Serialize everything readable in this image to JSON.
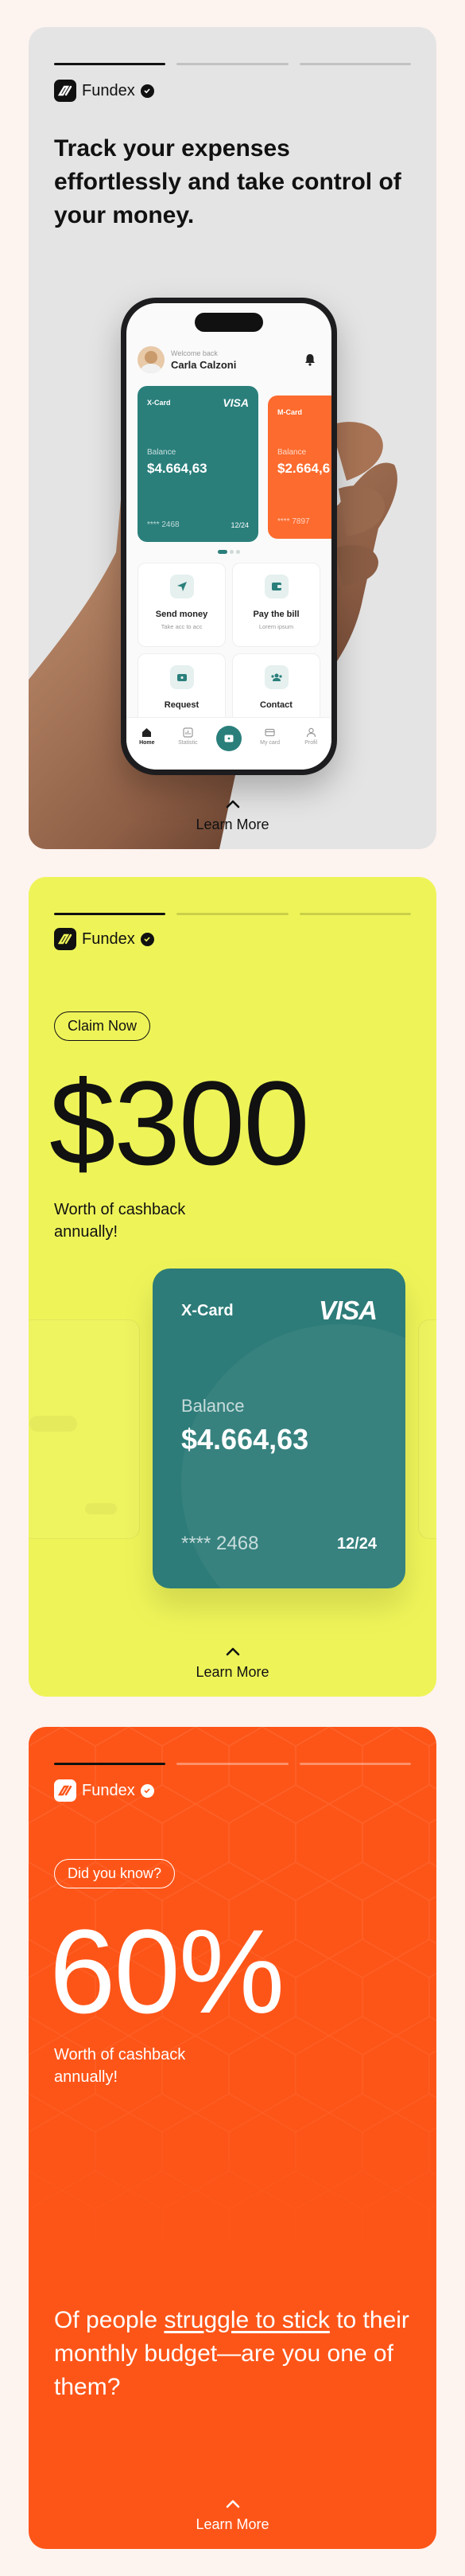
{
  "brand": {
    "name": "Fundex"
  },
  "slides": {
    "one": {
      "headline": "Track your expenses effortlessly and take control of your money.",
      "learn_more": "Learn More",
      "phone": {
        "welcome": "Welcome back",
        "user_name": "Carla Calzoni",
        "cards": [
          {
            "name": "X-Card",
            "network": "VISA",
            "balance_label": "Balance",
            "balance": "$4.664,63",
            "number": "**** 2468",
            "expiry": "12/24"
          },
          {
            "name": "M-Card",
            "balance_label": "Balance",
            "balance": "$2.664,6",
            "number": "**** 7897"
          }
        ],
        "actions": [
          {
            "title": "Send money",
            "subtitle": "Take acc to acc",
            "icon": "send-icon"
          },
          {
            "title": "Pay the bill",
            "subtitle": "Lorem ipsum",
            "icon": "bill-icon"
          },
          {
            "title": "Request",
            "subtitle": "",
            "icon": "wallet-icon"
          },
          {
            "title": "Contact",
            "subtitle": "",
            "icon": "contacts-icon"
          }
        ],
        "nav": [
          {
            "label": "Home",
            "icon": "home-icon"
          },
          {
            "label": "Statistic",
            "icon": "statistic-icon"
          },
          {
            "label": "",
            "icon": "wallet-center-icon"
          },
          {
            "label": "My card",
            "icon": "card-icon"
          },
          {
            "label": "Profil",
            "icon": "profile-icon"
          }
        ]
      }
    },
    "two": {
      "pill": "Claim Now",
      "big_number": "$300",
      "sub": "Worth of cashback annually!",
      "learn_more": "Learn More",
      "card": {
        "name": "X-Card",
        "network": "VISA",
        "balance_label": "Balance",
        "balance": "$4.664,63",
        "number": "**** 2468",
        "expiry": "12/24"
      }
    },
    "three": {
      "pill": "Did you know?",
      "big_number": "60%",
      "sub": "Worth of cashback annually!",
      "question_pre": "Of people ",
      "question_link": "struggle to stick",
      "question_post": " to their monthly budget—are you one of them?",
      "learn_more": "Learn More"
    }
  },
  "colors": {
    "slide_one_bg": "#e4e4e4",
    "slide_two_bg": "#eef458",
    "slide_three_bg": "#fd5518",
    "card_teal": "#2d7c79",
    "card_orange": "#fd6b2e"
  }
}
